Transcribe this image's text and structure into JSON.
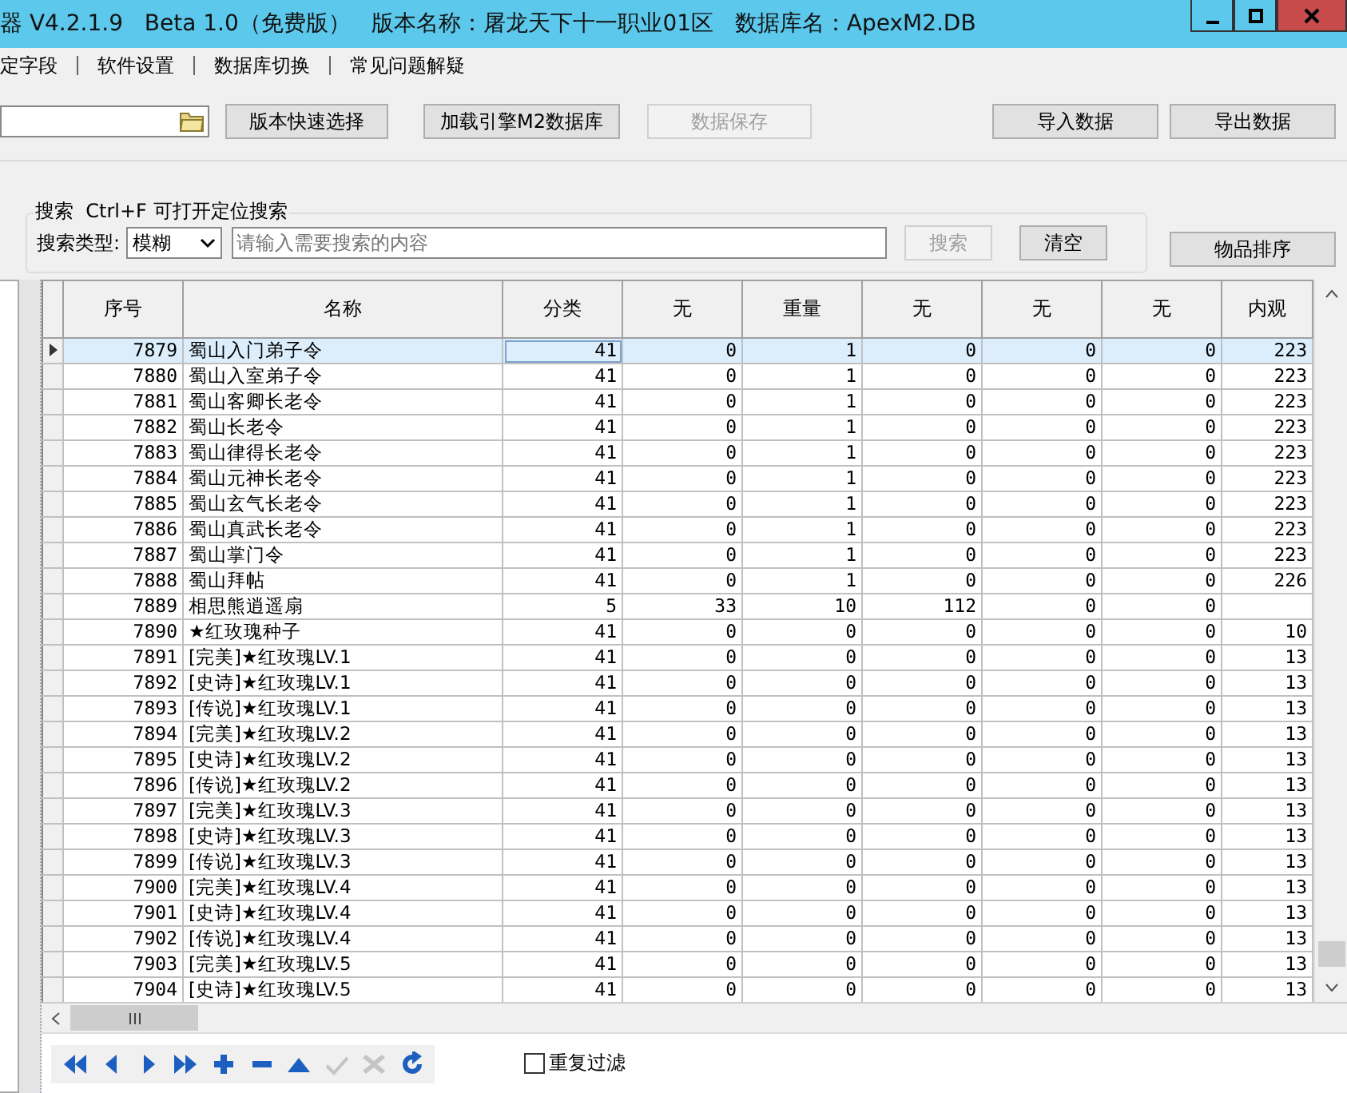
{
  "window": {
    "title": "器 V4.2.1.9   Beta 1.0（免费版）   版本名称：屠龙天下十一职业01区   数据库名：ApexM2.DB"
  },
  "menu": [
    "定字段",
    "软件设置",
    "数据库切换",
    "常见问题解疑"
  ],
  "toolbar": {
    "buttons": [
      {
        "label": "版本快速选择",
        "disabled": false
      },
      {
        "label": "加载引擎M2数据库",
        "disabled": false
      },
      {
        "label": "数据保存",
        "disabled": true
      }
    ],
    "right_buttons": [
      {
        "label": "导入数据",
        "disabled": false
      },
      {
        "label": "导出数据",
        "disabled": false
      }
    ]
  },
  "search": {
    "title": "搜索  Ctrl+F 可打开定位搜索",
    "type_label": "搜索类型:",
    "type_value": "模糊",
    "placeholder": "请输入需要搜索的内容",
    "search_button": {
      "label": "搜索",
      "disabled": true
    },
    "clear_button": {
      "label": "清空",
      "disabled": false
    }
  },
  "sort_button": {
    "label": "物品排序",
    "disabled": false
  },
  "table": {
    "columns": [
      "序号",
      "名称",
      "分类",
      "无",
      "重量",
      "无",
      "无",
      "无",
      "内观"
    ],
    "rows": [
      {
        "selected": true,
        "cells": [
          "7879",
          "蜀山入门弟子令",
          "41",
          "0",
          "1",
          "0",
          "0",
          "0",
          "223"
        ]
      },
      {
        "selected": false,
        "cells": [
          "7880",
          "蜀山入室弟子令",
          "41",
          "0",
          "1",
          "0",
          "0",
          "0",
          "223"
        ]
      },
      {
        "selected": false,
        "cells": [
          "7881",
          "蜀山客卿长老令",
          "41",
          "0",
          "1",
          "0",
          "0",
          "0",
          "223"
        ]
      },
      {
        "selected": false,
        "cells": [
          "7882",
          "蜀山长老令",
          "41",
          "0",
          "1",
          "0",
          "0",
          "0",
          "223"
        ]
      },
      {
        "selected": false,
        "cells": [
          "7883",
          "蜀山律得长老令",
          "41",
          "0",
          "1",
          "0",
          "0",
          "0",
          "223"
        ]
      },
      {
        "selected": false,
        "cells": [
          "7884",
          "蜀山元神长老令",
          "41",
          "0",
          "1",
          "0",
          "0",
          "0",
          "223"
        ]
      },
      {
        "selected": false,
        "cells": [
          "7885",
          "蜀山玄气长老令",
          "41",
          "0",
          "1",
          "0",
          "0",
          "0",
          "223"
        ]
      },
      {
        "selected": false,
        "cells": [
          "7886",
          "蜀山真武长老令",
          "41",
          "0",
          "1",
          "0",
          "0",
          "0",
          "223"
        ]
      },
      {
        "selected": false,
        "cells": [
          "7887",
          "蜀山掌门令",
          "41",
          "0",
          "1",
          "0",
          "0",
          "0",
          "223"
        ]
      },
      {
        "selected": false,
        "cells": [
          "7888",
          "蜀山拜帖",
          "41",
          "0",
          "1",
          "0",
          "0",
          "0",
          "226"
        ]
      },
      {
        "selected": false,
        "cells": [
          "7889",
          "相思熊逍遥扇",
          "5",
          "33",
          "10",
          "112",
          "0",
          "0",
          null
        ]
      },
      {
        "selected": false,
        "cells": [
          "7890",
          "★红玫瑰种子",
          "41",
          "0",
          "0",
          "0",
          "0",
          "0",
          "10"
        ]
      },
      {
        "selected": false,
        "cells": [
          "7891",
          "[完美]★红玫瑰LV.1",
          "41",
          "0",
          "0",
          "0",
          "0",
          "0",
          "13"
        ]
      },
      {
        "selected": false,
        "cells": [
          "7892",
          "[史诗]★红玫瑰LV.1",
          "41",
          "0",
          "0",
          "0",
          "0",
          "0",
          "13"
        ]
      },
      {
        "selected": false,
        "cells": [
          "7893",
          "[传说]★红玫瑰LV.1",
          "41",
          "0",
          "0",
          "0",
          "0",
          "0",
          "13"
        ]
      },
      {
        "selected": false,
        "cells": [
          "7894",
          "[完美]★红玫瑰LV.2",
          "41",
          "0",
          "0",
          "0",
          "0",
          "0",
          "13"
        ]
      },
      {
        "selected": false,
        "cells": [
          "7895",
          "[史诗]★红玫瑰LV.2",
          "41",
          "0",
          "0",
          "0",
          "0",
          "0",
          "13"
        ]
      },
      {
        "selected": false,
        "cells": [
          "7896",
          "[传说]★红玫瑰LV.2",
          "41",
          "0",
          "0",
          "0",
          "0",
          "0",
          "13"
        ]
      },
      {
        "selected": false,
        "cells": [
          "7897",
          "[完美]★红玫瑰LV.3",
          "41",
          "0",
          "0",
          "0",
          "0",
          "0",
          "13"
        ]
      },
      {
        "selected": false,
        "cells": [
          "7898",
          "[史诗]★红玫瑰LV.3",
          "41",
          "0",
          "0",
          "0",
          "0",
          "0",
          "13"
        ]
      },
      {
        "selected": false,
        "cells": [
          "7899",
          "[传说]★红玫瑰LV.3",
          "41",
          "0",
          "0",
          "0",
          "0",
          "0",
          "13"
        ]
      },
      {
        "selected": false,
        "cells": [
          "7900",
          "[完美]★红玫瑰LV.4",
          "41",
          "0",
          "0",
          "0",
          "0",
          "0",
          "13"
        ]
      },
      {
        "selected": false,
        "cells": [
          "7901",
          "[史诗]★红玫瑰LV.4",
          "41",
          "0",
          "0",
          "0",
          "0",
          "0",
          "13"
        ]
      },
      {
        "selected": false,
        "cells": [
          "7902",
          "[传说]★红玫瑰LV.4",
          "41",
          "0",
          "0",
          "0",
          "0",
          "0",
          "13"
        ]
      },
      {
        "selected": false,
        "cells": [
          "7903",
          "[完美]★红玫瑰LV.5",
          "41",
          "0",
          "0",
          "0",
          "0",
          "0",
          "13"
        ]
      },
      {
        "selected": false,
        "cells": [
          "7904",
          "[史诗]★红玫瑰LV.5",
          "41",
          "0",
          "0",
          "0",
          "0",
          "0",
          "13"
        ]
      }
    ]
  },
  "navigator": [
    {
      "kind": "first",
      "disabled": false
    },
    {
      "kind": "prior",
      "disabled": false
    },
    {
      "kind": "next",
      "disabled": false
    },
    {
      "kind": "last",
      "disabled": false
    },
    {
      "kind": "insert",
      "disabled": false
    },
    {
      "kind": "delete",
      "disabled": false
    },
    {
      "kind": "edit",
      "disabled": false
    },
    {
      "kind": "post",
      "disabled": true
    },
    {
      "kind": "cancel",
      "disabled": true
    },
    {
      "kind": "refresh",
      "disabled": false
    }
  ],
  "filter_checkbox": {
    "label": "重复过滤",
    "checked": false
  }
}
